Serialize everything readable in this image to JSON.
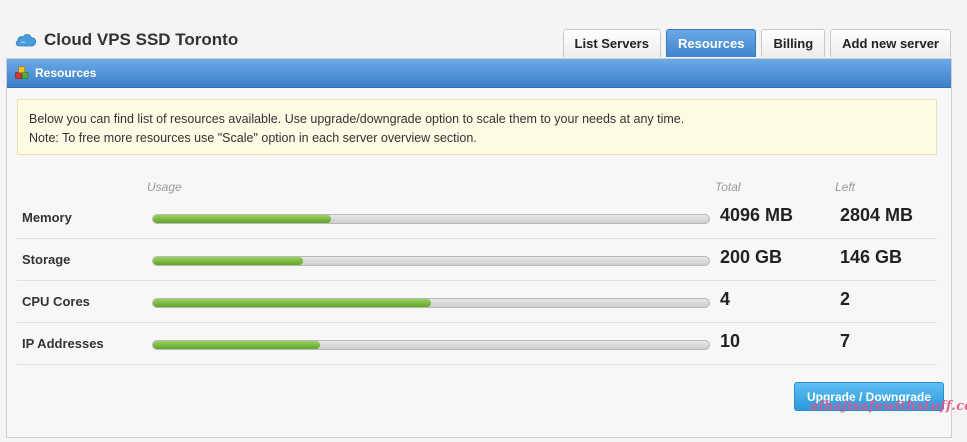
{
  "header": {
    "title": "Cloud VPS SSD Toronto",
    "brand_icon": "cloud-icon",
    "tabs": [
      {
        "label": "List Servers",
        "active": false
      },
      {
        "label": "Resources",
        "active": true
      },
      {
        "label": "Billing",
        "active": false
      },
      {
        "label": "Add new server",
        "active": false
      }
    ]
  },
  "panel": {
    "title": "Resources",
    "icon": "resources-icon",
    "notice": [
      "Below you can find list of resources available. Use upgrade/downgrade option to scale them to your needs at any time.",
      "Note: To free more resources use \"Scale\" option in each server overview section."
    ]
  },
  "table": {
    "headers": {
      "usage": "Usage",
      "total": "Total",
      "left": "Left"
    },
    "rows": [
      {
        "name": "Memory",
        "usage_fraction": 0.32,
        "total": "4096 MB",
        "left": "2804 MB"
      },
      {
        "name": "Storage",
        "usage_fraction": 0.27,
        "total": "200 GB",
        "left": "146 GB"
      },
      {
        "name": "CPU Cores",
        "usage_fraction": 0.5,
        "total": "4",
        "left": "2"
      },
      {
        "name": "IP Addresses",
        "usage_fraction": 0.3,
        "total": "10",
        "left": "7"
      }
    ]
  },
  "actions": {
    "upgrade_label": "Upgrade / Downgrade"
  },
  "watermark": "alhajisafewithstuff.com",
  "colors": {
    "accent": "#3f84cd",
    "bar_fill": "#6cb832",
    "button": "#2a98dc"
  }
}
